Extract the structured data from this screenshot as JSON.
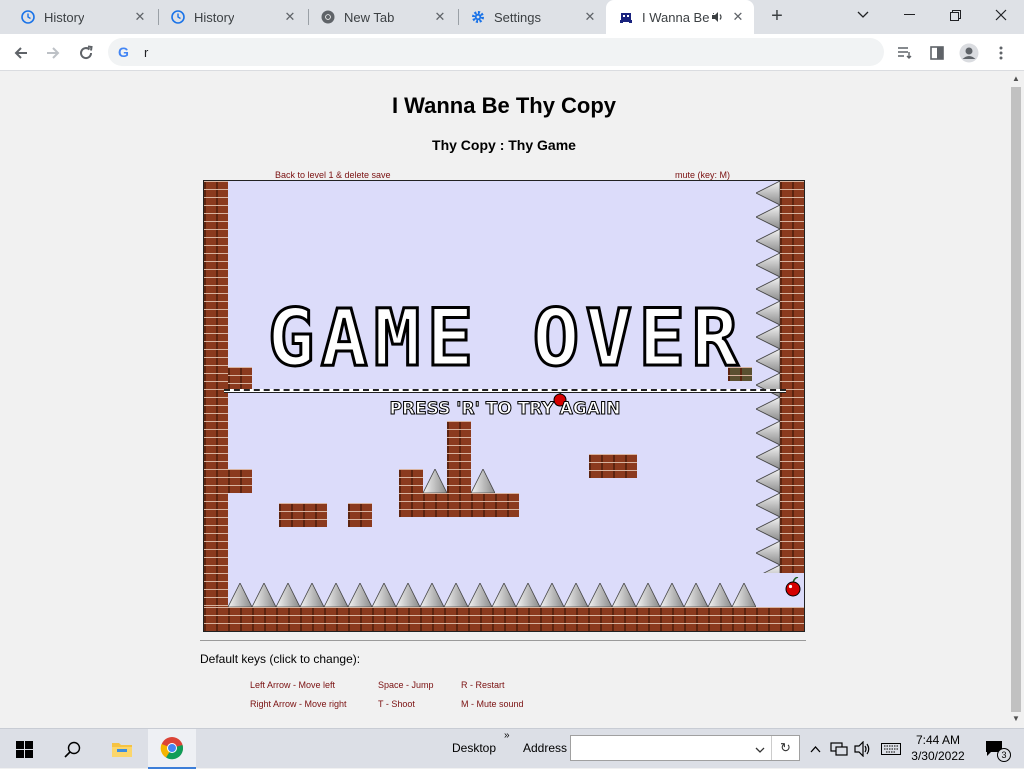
{
  "browser": {
    "tabs": [
      {
        "title": "History",
        "icon": "history-icon"
      },
      {
        "title": "History",
        "icon": "history-icon"
      },
      {
        "title": "New Tab",
        "icon": "chrome-icon"
      },
      {
        "title": "Settings",
        "icon": "gear-icon"
      },
      {
        "title": "I Wanna Be Thy Copy",
        "icon": "game-icon",
        "active": true
      }
    ],
    "address_value": "r"
  },
  "page": {
    "title": "I Wanna Be Thy Copy",
    "subtitle": "Thy Copy : Thy Game",
    "back_link": "Back to level 1 & delete save",
    "mute_link": "mute (key: M)",
    "game_over_text": "GAME OVER",
    "press_r_text": "PRESS 'R' TO TRY AGAIN",
    "keys_title": "Default keys (click to change):",
    "keys": {
      "left": "Left Arrow - Move left",
      "right": "Right Arrow - Move right",
      "jump": "Space - Jump",
      "shoot": "T - Shoot",
      "restart": "R - Restart",
      "mute": "M - Mute sound"
    }
  },
  "taskbar": {
    "desktop_label": "Desktop",
    "address_label": "Address",
    "time": "7:44 AM",
    "date": "3/30/2022",
    "notification_count": "3"
  }
}
